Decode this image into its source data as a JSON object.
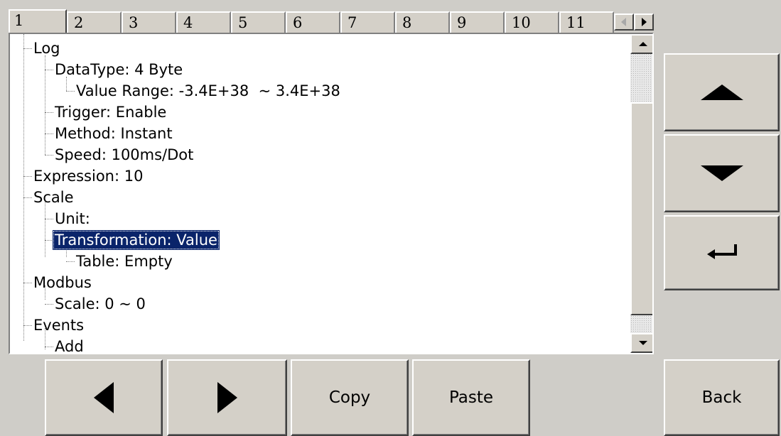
{
  "tabs": {
    "labels": [
      "1",
      "2",
      "3",
      "4",
      "5",
      "6",
      "7",
      "8",
      "9",
      "10",
      "11"
    ],
    "active": "1"
  },
  "tree": {
    "log": "Log",
    "datatype": "DataType: 4 Byte",
    "value_range": "Value Range: -3.4E+38  ~ 3.4E+38",
    "trigger": "Trigger: Enable",
    "method": "Method: Instant",
    "speed": "Speed: 100ms/Dot",
    "expression": "Expression: 10",
    "scale": "Scale",
    "unit": "Unit:",
    "transformation": "Transformation: Value",
    "table": "Table: Empty",
    "modbus": "Modbus",
    "modbus_scale": "Scale: 0 ~ 0",
    "events": "Events",
    "add": "Add",
    "selected": "Transformation: Value"
  },
  "buttons": {
    "copy": "Copy",
    "paste": "Paste",
    "back": "Back"
  },
  "icons": {
    "up": "triangle-up-icon",
    "down": "triangle-down-icon",
    "enter": "enter-return-icon",
    "left": "triangle-left-icon",
    "right": "triangle-right-icon"
  },
  "colors": {
    "selection": "#0a246a",
    "background": "#cfcdc8",
    "button_face": "#d4d0c8"
  }
}
